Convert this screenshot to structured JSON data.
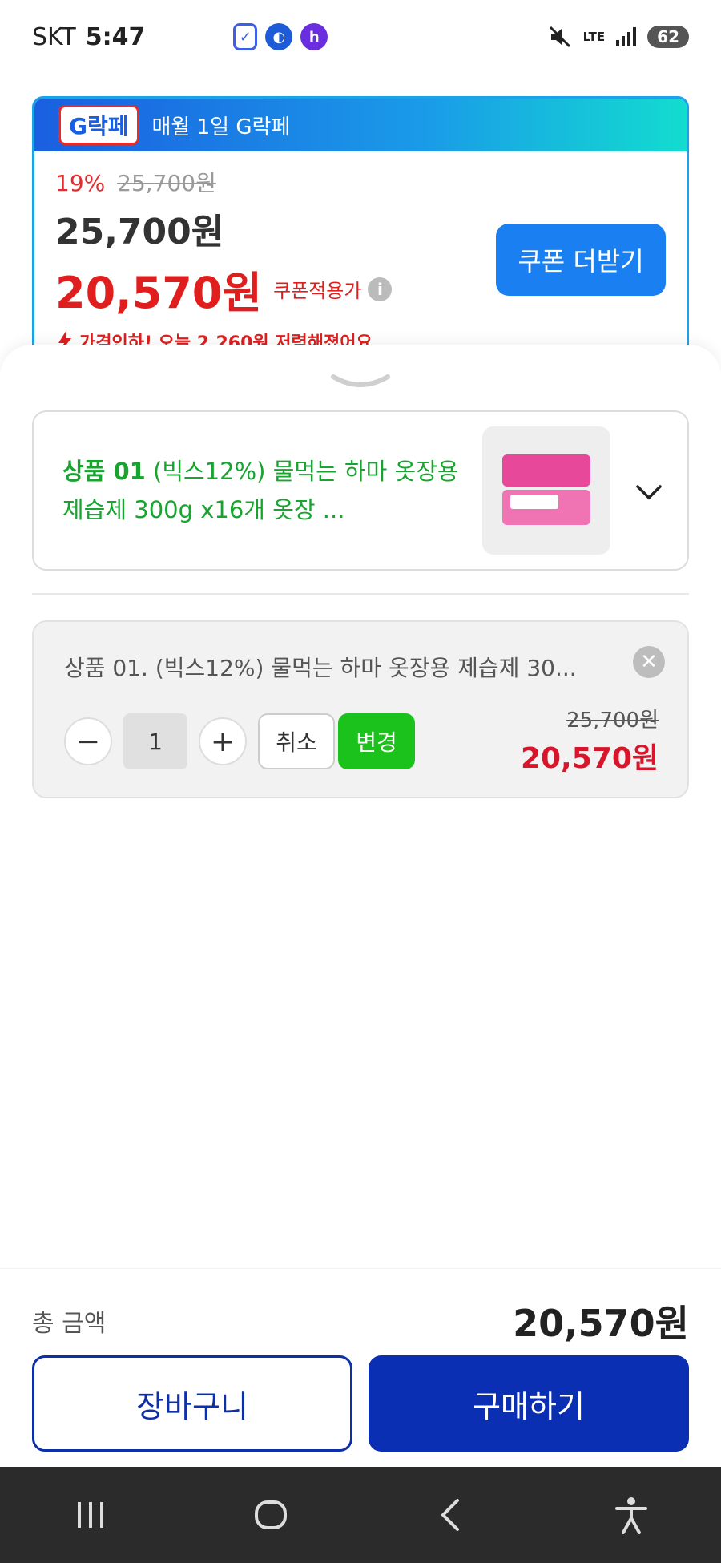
{
  "status_bar": {
    "carrier": "SKT",
    "time": "5:47",
    "network": "LTE",
    "battery": "62"
  },
  "promo": {
    "banner_text": "매월 1일 G락페",
    "logo_text": "G락페",
    "discount_pct": "19%",
    "original_price": "25,700원",
    "price": "25,700원",
    "coupon_price": "20,570원",
    "coupon_label": "쿠폰적용가",
    "price_cut_text": "가격인하! 오늘 2,260원 저렴해졌어요",
    "coupon_button": "쿠폰 더받기"
  },
  "option_select": {
    "prefix": "상품 01",
    "name": " (빅스12%) 물먹는 하마 옷장용 제습제 300g x16개 옷장 ..."
  },
  "selected_option": {
    "title": "상품 01. (빅스12%) 물먹는 하마 옷장용 제습제 30...",
    "quantity": "1",
    "cancel_label": "취소",
    "change_label": "변경",
    "original_price": "25,700원",
    "final_price": "20,570원"
  },
  "total": {
    "label": "총 금액",
    "value": "20,570원"
  },
  "actions": {
    "cart": "장바구니",
    "buy": "구매하기"
  },
  "colors": {
    "primary_blue": "#0a2fb3",
    "sale_red": "#e01e1e",
    "option_green": "#18a42f",
    "change_green": "#1bc21b"
  }
}
